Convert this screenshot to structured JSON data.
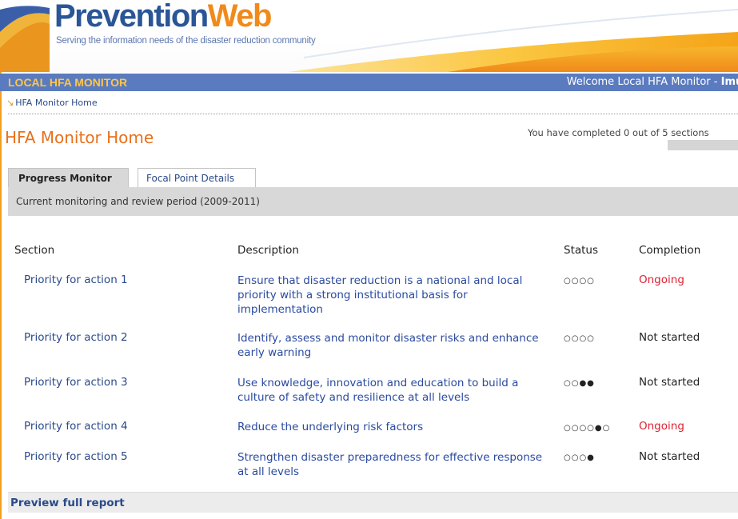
{
  "header": {
    "logo_prevention": "Prevention",
    "logo_web": "Web",
    "tagline": "Serving the information needs of the disaster reduction community"
  },
  "monitor_bar": {
    "title": "LOCAL HFA MONITOR",
    "welcome_prefix": "Welcome Local HFA Monitor - ",
    "welcome_user": "Imus"
  },
  "breadcrumb": {
    "item": "HFA Monitor Home"
  },
  "page": {
    "title": "HFA Monitor Home",
    "progress_text": "You have completed 0 out of 5 sections",
    "progress_fraction": 0
  },
  "tabs": [
    {
      "label": "Progress Monitor",
      "active": true
    },
    {
      "label": "Focal Point Details",
      "active": false
    }
  ],
  "period": "Current monitoring and review period (2009-2011)",
  "table": {
    "headers": {
      "section": "Section",
      "description": "Description",
      "status": "Status",
      "completion": "Completion"
    },
    "rows": [
      {
        "section": "Priority for action 1",
        "description": "Ensure that disaster reduction is a national and local priority with a strong institutional basis for implementation",
        "status": "○○○○",
        "completion": "Ongoing"
      },
      {
        "section": "Priority for action 2",
        "description": "Identify, assess and monitor disaster risks and enhance early warning",
        "status": "○○○○",
        "completion": "Not started"
      },
      {
        "section": "Priority for action 3",
        "description": "Use knowledge, innovation and education to build a culture of safety and resilience at all levels",
        "status": "○○●●",
        "completion": "Not started"
      },
      {
        "section": "Priority for action 4",
        "description": "Reduce the underlying risk factors",
        "status": "○○○○●○",
        "completion": "Ongoing"
      },
      {
        "section": "Priority for action 5",
        "description": "Strengthen disaster preparedness for effective response at all levels",
        "status": "○○○●",
        "completion": "Not started"
      }
    ]
  },
  "footer": {
    "preview_link": "Preview full report"
  },
  "colors": {
    "brand_blue": "#2a5597",
    "brand_orange": "#f08a1a",
    "bar_blue": "#5a7bbf",
    "ongoing_red": "#e02030"
  }
}
